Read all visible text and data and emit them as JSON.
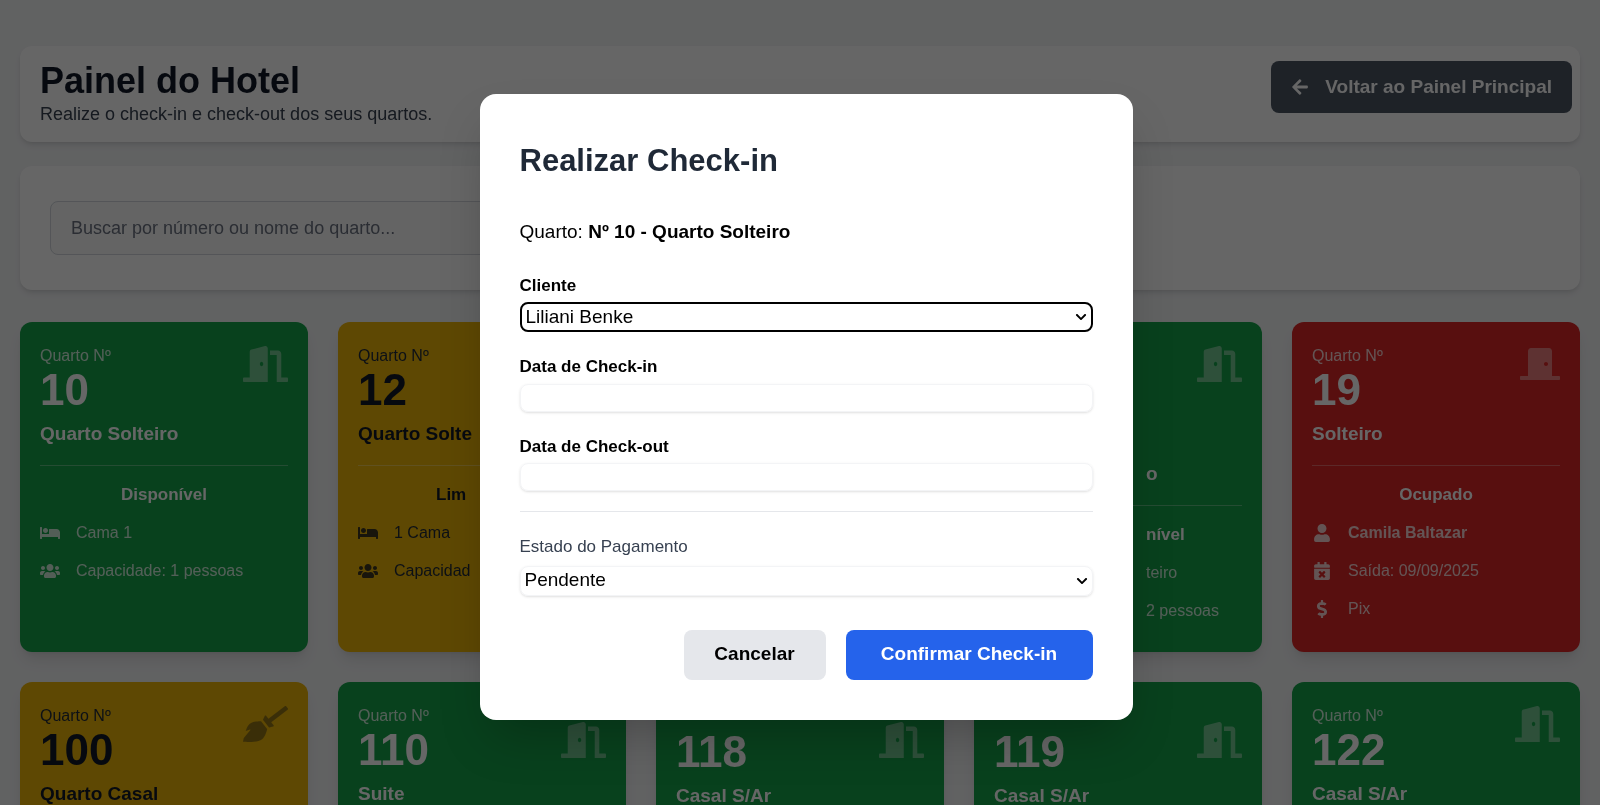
{
  "header": {
    "title": "Painel do Hotel",
    "subtitle": "Realize o check-in e check-out dos seus quartos.",
    "back_button": "Voltar ao Painel Principal"
  },
  "search": {
    "placeholder": "Buscar por número ou nome do quarto..."
  },
  "room_rows": [
    [
      {
        "kind": "available",
        "label": "Quarto Nº",
        "number": "10",
        "name": "Quarto Solteiro",
        "status": "Disponível",
        "details": [
          {
            "kind": "bed",
            "text": "Cama 1"
          },
          {
            "kind": "people",
            "text": "Capacidade: 1 pessoas"
          }
        ]
      },
      {
        "kind": "cleaning",
        "label": "Quarto Nº",
        "number": "12",
        "name": "Quarto Solte",
        "status": "Lim",
        "details": [
          {
            "kind": "bed",
            "text": "1 Cama"
          },
          {
            "kind": "people",
            "text": "Capacidad"
          }
        ]
      },
      {
        "kind": "available",
        "name": "o",
        "status": "nível",
        "details": [
          {
            "kind": "hidden",
            "text": "teiro"
          },
          {
            "kind": "hidden",
            "text": "2 pessoas"
          }
        ]
      },
      {
        "kind": "occupied",
        "label": "Quarto Nº",
        "number": "19",
        "name": "Solteiro",
        "status": "Ocupado",
        "details": [
          {
            "kind": "person",
            "text": "Camila Baltazar"
          },
          {
            "kind": "calendar",
            "text": "Saída: 09/09/2025"
          },
          {
            "kind": "money",
            "text": "Pix"
          }
        ]
      }
    ],
    [
      {
        "kind": "cleaning",
        "label": "Quarto Nº",
        "number": "100",
        "name": "Quarto Casal"
      },
      {
        "kind": "available",
        "label": "Quarto Nº",
        "number": "110",
        "name": "Suite"
      },
      {
        "kind": "available",
        "number": "118",
        "name": "Casal S/Ar"
      },
      {
        "kind": "available",
        "number": "119",
        "name": "Casal S/Ar"
      },
      {
        "kind": "available",
        "label": "Quarto Nº",
        "number": "122",
        "name": "Casal S/Ar"
      }
    ]
  ],
  "modal": {
    "title": "Realizar Check-in",
    "room_line": "Quarto: **Nº 10 - Quarto Solteiro**",
    "fields": [
      {
        "kind": "select",
        "label": "Cliente",
        "value": "Liliani Benke",
        "focused": true
      },
      {
        "kind": "date",
        "label": "Data de Check-in",
        "focused": false
      },
      {
        "kind": "date",
        "label": "Data de Check-out",
        "focused": false
      }
    ],
    "payment": {
      "label": "Estado do Pagamento",
      "value": "Pendente"
    },
    "buttons": [
      {
        "kind": "secondary",
        "label": "Cancelar"
      },
      {
        "kind": "primary",
        "label": "Confirmar Check-in"
      }
    ]
  }
}
